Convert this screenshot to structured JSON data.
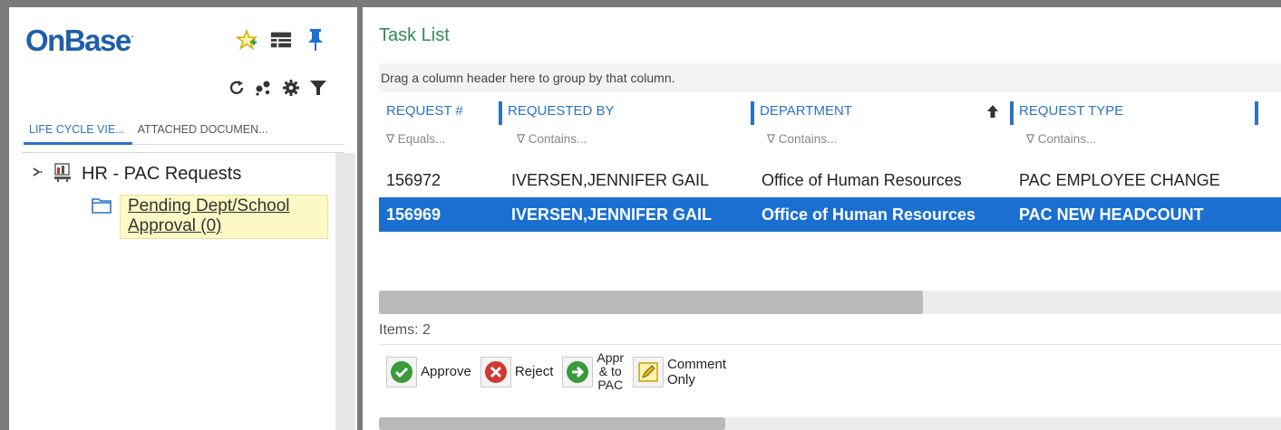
{
  "left_panel": {
    "logo": "OnBase",
    "logo_mark": "·",
    "top_icons": [
      "favorite-add-icon",
      "layout-icon",
      "pin-icon"
    ],
    "toolbar_icons": [
      "refresh-icon",
      "workflow-icon",
      "settings-icon",
      "filter-icon"
    ],
    "tabs": [
      {
        "label": "LIFE CYCLE VIE...",
        "active": true
      },
      {
        "label": "ATTACHED DOCUMEN...",
        "active": false
      }
    ],
    "tree": {
      "lifecycle_label": "HR - PAC Requests",
      "queue_line1": "Pending Dept/School",
      "queue_line2": "Approval (0)"
    }
  },
  "right_panel": {
    "title": "Task List",
    "group_hint": "Drag a column header here to group by that column.",
    "columns": [
      {
        "label": "REQUEST #",
        "filter": "∇ Equals..."
      },
      {
        "label": "REQUESTED BY",
        "filter": "∇ Contains..."
      },
      {
        "label": "DEPARTMENT",
        "filter": "∇ Contains..."
      },
      {
        "label": "REQUEST TYPE",
        "filter": "∇ Contains..."
      }
    ],
    "rows": [
      {
        "request_no": "156972",
        "requested_by": "IVERSEN,JENNIFER GAIL",
        "department": "Office of Human Resources",
        "request_type": "PAC EMPLOYEE CHANGE",
        "selected": false
      },
      {
        "request_no": "156969",
        "requested_by": "IVERSEN,JENNIFER GAIL",
        "department": "Office of Human Resources",
        "request_type": "PAC NEW HEADCOUNT",
        "selected": true
      }
    ],
    "items_count": "Items: 2",
    "actions": {
      "approve": "Approve",
      "reject": "Reject",
      "appr_to_pac_1": "Appr",
      "appr_to_pac_2": "& to",
      "appr_to_pac_3": "PAC",
      "comment_1": "Comment",
      "comment_2": "Only"
    }
  },
  "colors": {
    "accent": "#2a73c4",
    "selected_row": "#1a6fd0",
    "title_green": "#2e8b57",
    "queue_highlight": "#fdf9c4",
    "logo_blue": "#1f5fa8"
  }
}
